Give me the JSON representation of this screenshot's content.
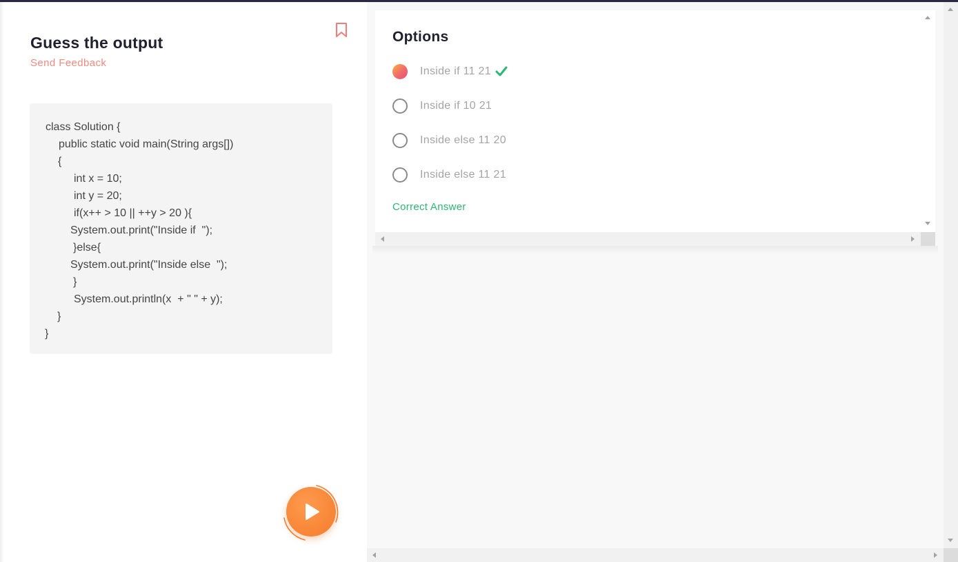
{
  "question": {
    "title": "Guess the output",
    "feedback_label": "Send Feedback",
    "bookmark_icon": "bookmark-icon",
    "code_lines": [
      "class Solution {",
      "public static void main(String args[])",
      "{",
      "int x = 10;",
      "int y = 20;",
      "if(x++ > 10 || ++y > 20 ){",
      "System.out.print(\"Inside if  \");",
      "}else{",
      "System.out.print(\"Inside else  \");",
      "}",
      "System.out.println(x  + \" \" + y);",
      "}",
      "}"
    ],
    "run_icon": "play-icon"
  },
  "options": {
    "title": "Options",
    "items": [
      {
        "label": "Inside if 11 21",
        "selected": true,
        "correct": true
      },
      {
        "label": "Inside if 10 21",
        "selected": false,
        "correct": false
      },
      {
        "label": "Inside else 11 20",
        "selected": false,
        "correct": false
      },
      {
        "label": "Inside else 11 21",
        "selected": false,
        "correct": false
      }
    ],
    "result_label": "Correct Answer"
  },
  "colors": {
    "accent": "#f28a80",
    "play": "#f47c2c",
    "correct": "#2bb673",
    "title": "#1f1f2e"
  }
}
